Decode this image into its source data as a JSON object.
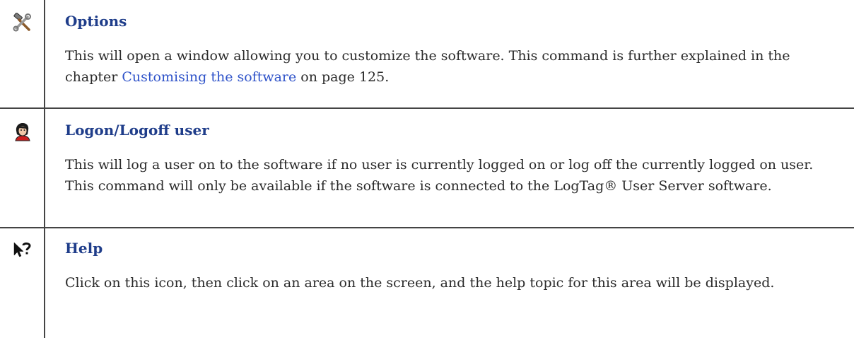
{
  "rows": [
    {
      "icon": "tools-icon",
      "title": "Options",
      "desc_before": "This will open a window allowing you to customize the software. This command is further explained in the chapter ",
      "link_text": "Customising the software",
      "desc_after": " on page 125."
    },
    {
      "icon": "user-logon-icon",
      "title": "Logon/Logoff user",
      "desc": "This will log a user on to the software if no user is currently logged on or log off the currently logged on user. This command will only be available if the software is connected to the LogTag® User Server software."
    },
    {
      "icon": "help-pointer-icon",
      "title": "Help",
      "desc": "Click on this icon, then click on an area on the screen, and the help topic for this area will be displayed."
    }
  ],
  "colors": {
    "title": "#1f3d8a",
    "link": "#2f53c9",
    "text": "#2b2b2b",
    "rule": "#444444"
  }
}
